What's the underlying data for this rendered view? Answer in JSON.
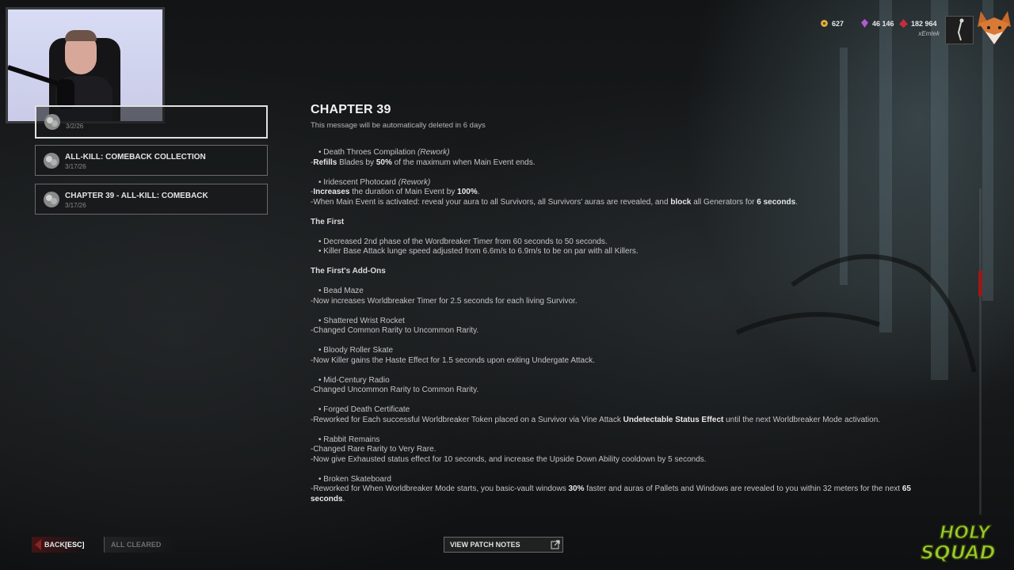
{
  "currencies": [
    {
      "icon": "bloodpoints-icon",
      "value": "627",
      "color": "#e0b040"
    },
    {
      "icon": "iridescent-shards-icon",
      "value": "46 146",
      "color": "#b25bd6"
    },
    {
      "icon": "auric-cells-icon",
      "value": "182 964",
      "color": "#c0303a"
    }
  ],
  "user": {
    "name": "xEmtek"
  },
  "messages": [
    {
      "title": "",
      "date": "3/2/26",
      "selected": true
    },
    {
      "title": "ALL-KILL: COMEBACK COLLECTION",
      "date": "3/17/26",
      "selected": false
    },
    {
      "title": "CHAPTER 39 - ALL-KILL: COMEBACK",
      "date": "3/17/26",
      "selected": false
    }
  ],
  "content": {
    "title": "CHAPTER 39",
    "expire": "This message will be automatically deleted in 6 days",
    "lines": [
      {
        "type": "bullet",
        "segments": [
          {
            "t": "• Death Throes Compilation "
          },
          {
            "t": "(Rework)",
            "i": true
          }
        ]
      },
      {
        "type": "text",
        "segments": [
          {
            "t": "-"
          },
          {
            "t": "Refills",
            "b": true
          },
          {
            "t": " Blades by "
          },
          {
            "t": "50%",
            "b": true
          },
          {
            "t": " of the maximum when Main Event ends."
          }
        ]
      },
      {
        "type": "gap"
      },
      {
        "type": "bullet",
        "segments": [
          {
            "t": "• Iridescent Photocard "
          },
          {
            "t": "(Rework)",
            "i": true
          }
        ]
      },
      {
        "type": "text",
        "segments": [
          {
            "t": "-"
          },
          {
            "t": "Increases",
            "b": true
          },
          {
            "t": " the duration of Main Event by "
          },
          {
            "t": "100%",
            "b": true
          },
          {
            "t": "."
          }
        ]
      },
      {
        "type": "text",
        "segments": [
          {
            "t": "-When Main Event is activated: reveal your aura to all Survivors, all Survivors' auras are revealed, and "
          },
          {
            "t": "block",
            "b": true
          },
          {
            "t": " all Generators for "
          },
          {
            "t": "6 seconds",
            "b": true
          },
          {
            "t": "."
          }
        ]
      },
      {
        "type": "gap"
      },
      {
        "type": "heading",
        "segments": [
          {
            "t": "The First"
          }
        ]
      },
      {
        "type": "gap"
      },
      {
        "type": "bullet",
        "segments": [
          {
            "t": "• Decreased 2nd phase of the Wordbreaker Timer from 60 seconds to 50 seconds."
          }
        ]
      },
      {
        "type": "bullet",
        "segments": [
          {
            "t": "• Killer Base Attack lunge speed adjusted from 6.6m/s to 6.9m/s to be on par with all Killers."
          }
        ]
      },
      {
        "type": "gap"
      },
      {
        "type": "heading",
        "segments": [
          {
            "t": "The First's Add-Ons"
          }
        ]
      },
      {
        "type": "gap"
      },
      {
        "type": "bullet",
        "segments": [
          {
            "t": "• Bead Maze"
          }
        ]
      },
      {
        "type": "text",
        "segments": [
          {
            "t": "-Now increases Worldbreaker Timer for 2.5 seconds for each living Survivor."
          }
        ]
      },
      {
        "type": "gap"
      },
      {
        "type": "bullet",
        "segments": [
          {
            "t": "• Shattered Wrist Rocket"
          }
        ]
      },
      {
        "type": "text",
        "segments": [
          {
            "t": "-Changed Common Rarity to Uncommon Rarity."
          }
        ]
      },
      {
        "type": "gap"
      },
      {
        "type": "bullet",
        "segments": [
          {
            "t": "• Bloody Roller Skate"
          }
        ]
      },
      {
        "type": "text",
        "segments": [
          {
            "t": "-Now Killer gains the Haste Effect for 1.5 seconds upon exiting Undergate Attack."
          }
        ]
      },
      {
        "type": "gap"
      },
      {
        "type": "bullet",
        "segments": [
          {
            "t": "• Mid-Century Radio"
          }
        ]
      },
      {
        "type": "text",
        "segments": [
          {
            "t": "-Changed Uncommon Rarity to Common Rarity."
          }
        ]
      },
      {
        "type": "gap"
      },
      {
        "type": "bullet",
        "segments": [
          {
            "t": "• Forged Death Certificate"
          }
        ]
      },
      {
        "type": "text",
        "segments": [
          {
            "t": "-Reworked for Each successful Worldbreaker Token placed on a Survivor via Vine Attack "
          },
          {
            "t": "Undetectable Status Effect",
            "b": true
          },
          {
            "t": " until the next Worldbreaker Mode activation."
          }
        ]
      },
      {
        "type": "gap"
      },
      {
        "type": "bullet",
        "segments": [
          {
            "t": "• Rabbit Remains"
          }
        ]
      },
      {
        "type": "text",
        "segments": [
          {
            "t": "-Changed Rare Rarity to Very Rare."
          }
        ]
      },
      {
        "type": "text",
        "segments": [
          {
            "t": "-Now give Exhausted status effect for 10 seconds, and increase the Upside Down Ability cooldown by 5 seconds."
          }
        ]
      },
      {
        "type": "gap"
      },
      {
        "type": "bullet",
        "segments": [
          {
            "t": "• Broken Skateboard"
          }
        ]
      },
      {
        "type": "text",
        "segments": [
          {
            "t": "-Reworked for When Worldbreaker Mode starts, you basic-vault windows "
          },
          {
            "t": "30%",
            "b": true
          },
          {
            "t": " faster and auras of Pallets and Windows are revealed to you within 32 meters for the next "
          },
          {
            "t": "65",
            "b": true
          }
        ]
      },
      {
        "type": "text",
        "segments": [
          {
            "t": "seconds",
            "b": true
          },
          {
            "t": "."
          }
        ]
      }
    ]
  },
  "buttons": {
    "back_label": "BACK",
    "back_key": "[ESC]",
    "cleared_label": "ALL CLEARED",
    "patch_label": "VIEW PATCH NOTES"
  },
  "logo": {
    "line1": "HOLY",
    "line2": "SQUAD"
  },
  "accent_color": "#9a1a1a"
}
